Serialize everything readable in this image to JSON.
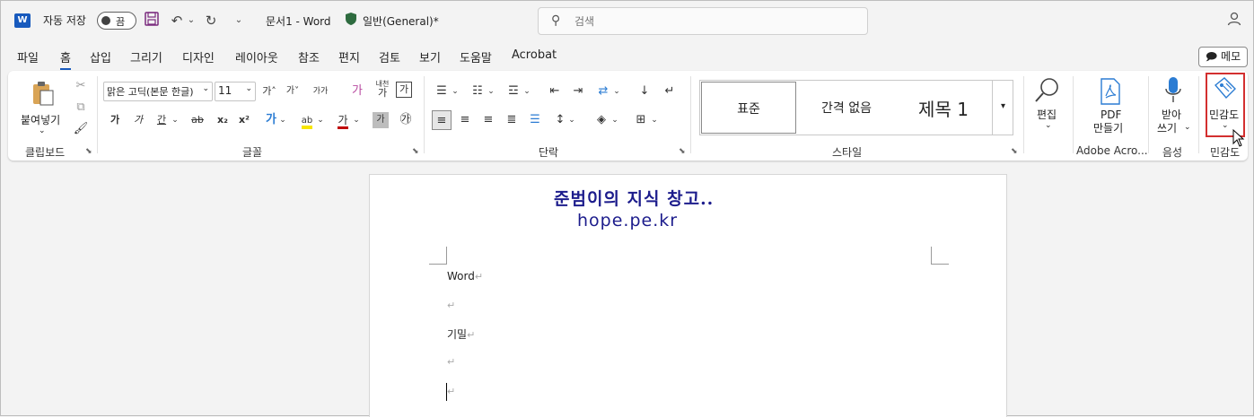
{
  "titlebar": {
    "app_icon": "W",
    "autosave_label": "자동 저장",
    "autosave_state": "끔",
    "doc_title": "문서1  -  Word",
    "sensitivity_label": "일반(General)*",
    "search_placeholder": "검색",
    "icons": [
      "word-logo-icon",
      "save-icon",
      "undo-icon",
      "redo-icon",
      "shield-icon",
      "search-icon",
      "user-icon"
    ]
  },
  "tabs": [
    "파일",
    "홈",
    "삽입",
    "그리기",
    "디자인",
    "레이아웃",
    "참조",
    "편지",
    "검토",
    "보기",
    "도움말",
    "Acrobat"
  ],
  "memo_button": "메모",
  "ribbon": {
    "clipboard": {
      "paste_label": "붙여넣기",
      "group_label": "클립보드"
    },
    "font": {
      "name": "맑은 고딕(본문 한글)",
      "size": "11",
      "grow": "가˄",
      "shrink": "가˅",
      "change_case": "가가",
      "clear_format": "가",
      "phonetic_top": "내천",
      "phonetic_bottom": "가",
      "box_char": "가",
      "bold": "가",
      "italic": "가",
      "underline": "간",
      "strike": "ab",
      "subscript": "x₂",
      "superscript": "x²",
      "effects": "가",
      "highlight": "ab",
      "font_color": "가",
      "shading": "가",
      "enclose": "㉮",
      "group_label": "글꼴"
    },
    "paragraph": {
      "group_label": "단락"
    },
    "styles": {
      "items": [
        "표준",
        "간격 없음",
        "제목 1"
      ],
      "group_label": "스타일"
    },
    "editing": {
      "label": "편집"
    },
    "acrobat": {
      "label_line1": "PDF",
      "label_line2": "만들기",
      "group_label": "Adobe Acro..."
    },
    "voice": {
      "label_line1": "받아",
      "label_line2": "쓰기",
      "group_label": "음성"
    },
    "sensitivity": {
      "label": "민감도",
      "group_label": "민감도"
    },
    "accent_color": "#185abd",
    "highlight_color": "#d32f2f"
  },
  "document": {
    "watermark_line1": "준범이의 지식 창고..",
    "watermark_line2": "hope.pe.kr",
    "paragraphs": [
      "Word",
      "",
      "기밀",
      "",
      ""
    ],
    "paragraph_mark": "↵"
  }
}
